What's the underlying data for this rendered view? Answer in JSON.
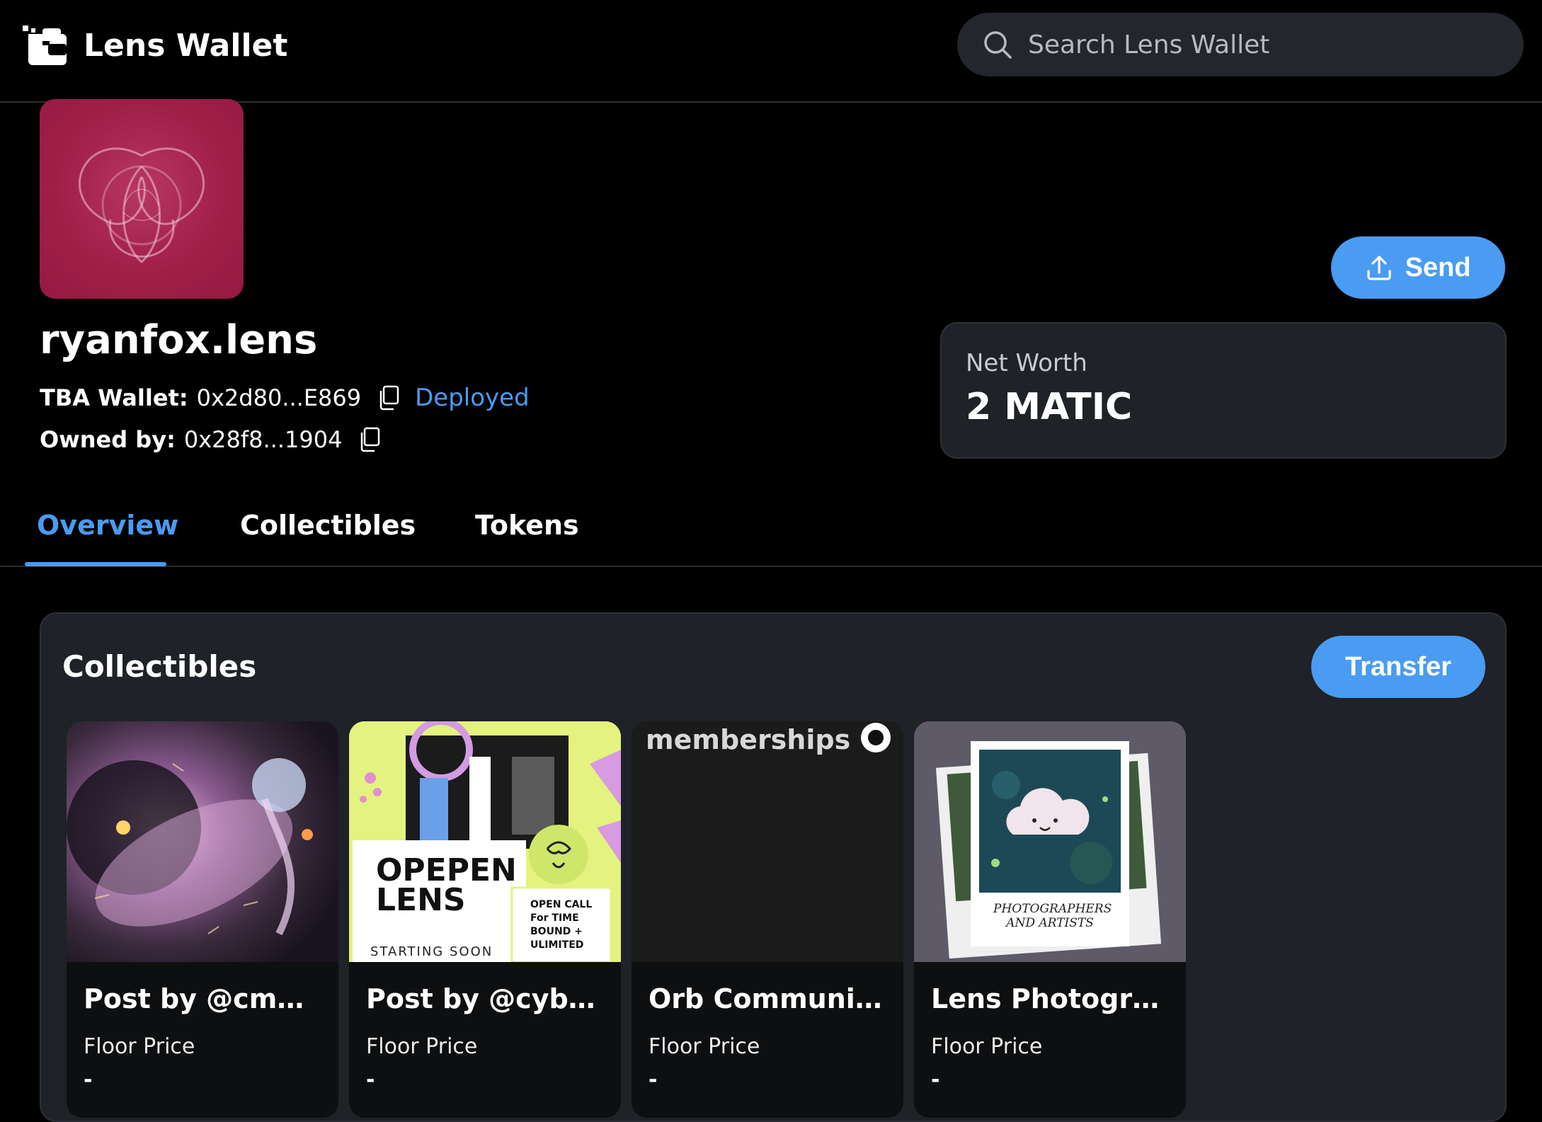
{
  "app": {
    "name": "Lens Wallet",
    "search_placeholder": "Search Lens Wallet"
  },
  "profile": {
    "handle": "ryanfox.lens",
    "tba_label": "TBA Wallet:",
    "tba_address": "0x2d80...E869",
    "status": "Deployed",
    "owner_label": "Owned by:",
    "owner_address": "0x28f8...1904"
  },
  "actions": {
    "send_label": "Send",
    "transfer_label": "Transfer"
  },
  "networth": {
    "label": "Net Worth",
    "value": "2 MATIC"
  },
  "tabs": [
    {
      "label": "Overview",
      "active": true
    },
    {
      "label": "Collectibles",
      "active": false
    },
    {
      "label": "Tokens",
      "active": false
    }
  ],
  "collectibles": {
    "title": "Collectibles",
    "items": [
      {
        "title": "Post by @cmn_…",
        "floor_label": "Floor Price",
        "floor_value": "-"
      },
      {
        "title": "Post by @cybers…",
        "floor_label": "Floor Price",
        "floor_value": "-",
        "image_text": {
          "headline": "OPEPEN LENS",
          "footer": "STARTING SOON",
          "callout": "OPEN CALL For TIME BOUND + ULIMITED"
        }
      },
      {
        "title": "Orb Communities",
        "floor_label": "Floor Price",
        "floor_value": "-",
        "image_text": {
          "header": "memberships"
        }
      },
      {
        "title": "Lens Photograph…",
        "floor_label": "Floor Price",
        "floor_value": "-",
        "image_text": {
          "caption": "PHOTOGRAPHERS AND ARTISTS"
        }
      }
    ]
  },
  "colors": {
    "accent": "#4a9bf2",
    "background": "#000000",
    "panel": "#1f2226",
    "avatar": "#a11f49"
  },
  "icons": [
    "wallet-logo-icon",
    "search-icon",
    "copy-icon",
    "upload-icon"
  ]
}
